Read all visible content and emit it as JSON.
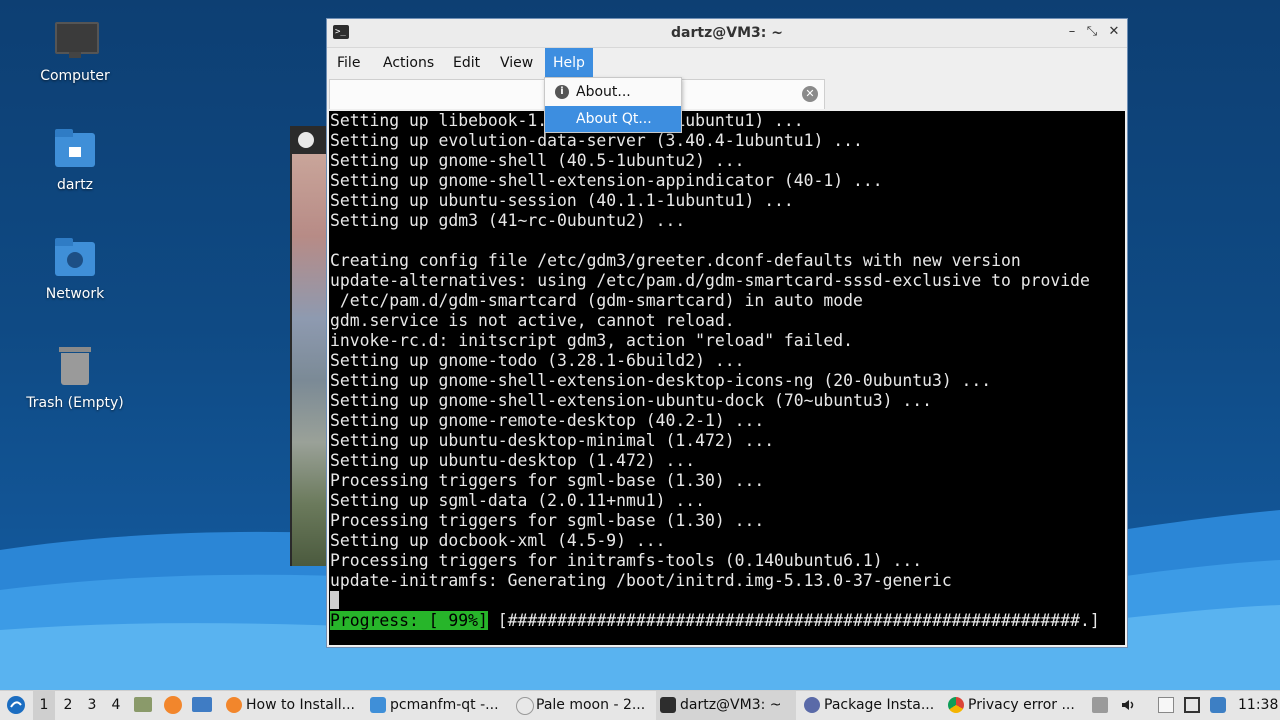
{
  "desktop": {
    "icons": [
      {
        "label": "Computer"
      },
      {
        "label": "dartz"
      },
      {
        "label": "Network"
      },
      {
        "label": "Trash (Empty)"
      }
    ]
  },
  "window": {
    "title": "dartz@VM3: ~",
    "controls": {
      "minimize": "–",
      "maximize": "⤡",
      "close": "✕"
    },
    "menu": [
      "File",
      "Actions",
      "Edit",
      "View",
      "Help"
    ],
    "active_menu": "Help",
    "tab": {
      "label": "dartz@VM3: ~",
      "visible_label": "dart"
    },
    "help_menu": {
      "items": [
        "About...",
        "About Qt..."
      ],
      "highlighted": "About Qt..."
    }
  },
  "terminal": {
    "lines": [
      "Setting up libebook-1.2-20 (3.40.4-1ubuntu1) ...",
      "Setting up evolution-data-server (3.40.4-1ubuntu1) ...",
      "Setting up gnome-shell (40.5-1ubuntu2) ...",
      "Setting up gnome-shell-extension-appindicator (40-1) ...",
      "Setting up ubuntu-session (40.1.1-1ubuntu1) ...",
      "Setting up gdm3 (41~rc-0ubuntu2) ...",
      "",
      "Creating config file /etc/gdm3/greeter.dconf-defaults with new version",
      "update-alternatives: using /etc/pam.d/gdm-smartcard-sssd-exclusive to provide",
      " /etc/pam.d/gdm-smartcard (gdm-smartcard) in auto mode",
      "gdm.service is not active, cannot reload.",
      "invoke-rc.d: initscript gdm3, action \"reload\" failed.",
      "Setting up gnome-todo (3.28.1-6build2) ...",
      "Setting up gnome-shell-extension-desktop-icons-ng (20-0ubuntu3) ...",
      "Setting up gnome-shell-extension-ubuntu-dock (70~ubuntu3) ...",
      "Setting up gnome-remote-desktop (40.2-1) ...",
      "Setting up ubuntu-desktop-minimal (1.472) ...",
      "Setting up ubuntu-desktop (1.472) ...",
      "Processing triggers for sgml-base (1.30) ...",
      "Setting up sgml-data (2.0.11+nmu1) ...",
      "Processing triggers for sgml-base (1.30) ...",
      "Setting up docbook-xml (4.5-9) ...",
      "Processing triggers for initramfs-tools (0.140ubuntu6.1) ...",
      "update-initramfs: Generating /boot/initrd.img-5.13.0-37-generic"
    ],
    "progress_label": "Progress: [ 99%]",
    "progress_bar": " [##########################################################.]",
    "progress_percent": 99
  },
  "taskbar": {
    "workspaces": [
      "1",
      "2",
      "3",
      "4"
    ],
    "active_workspace": "1",
    "tasks": [
      {
        "label": "How to Install...",
        "icon": "firefox-icon"
      },
      {
        "label": "pcmanfm-qt -...",
        "icon": "folder-icon"
      },
      {
        "label": "Pale moon - 2...",
        "icon": "palemoon-icon"
      },
      {
        "label": "dartz@VM3: ~",
        "icon": "terminal-icon"
      },
      {
        "label": "Package Insta...",
        "icon": "package-icon"
      },
      {
        "label": "Privacy error ...",
        "icon": "chrome-icon"
      }
    ],
    "active_task": "dartz@VM3: ~",
    "clock": "11:38"
  },
  "colors": {
    "accent": "#3d8ee0",
    "progress_green": "#27b52a",
    "terminal_bg": "#000000",
    "desktop_top": "#0d3f73"
  }
}
